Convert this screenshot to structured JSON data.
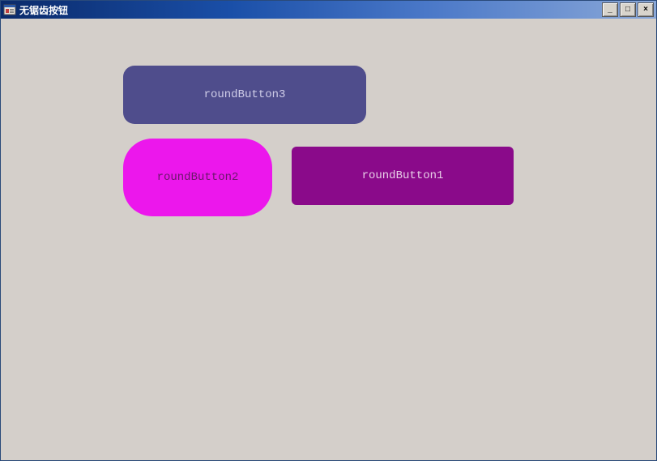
{
  "window": {
    "title": "无锯齿按钮"
  },
  "controls": {
    "minimize": "_",
    "maximize": "□",
    "close": "×"
  },
  "buttons": {
    "rb3": {
      "label": "roundButton3"
    },
    "rb2": {
      "label": "roundButton2"
    },
    "rb1": {
      "label": "roundButton1"
    }
  }
}
